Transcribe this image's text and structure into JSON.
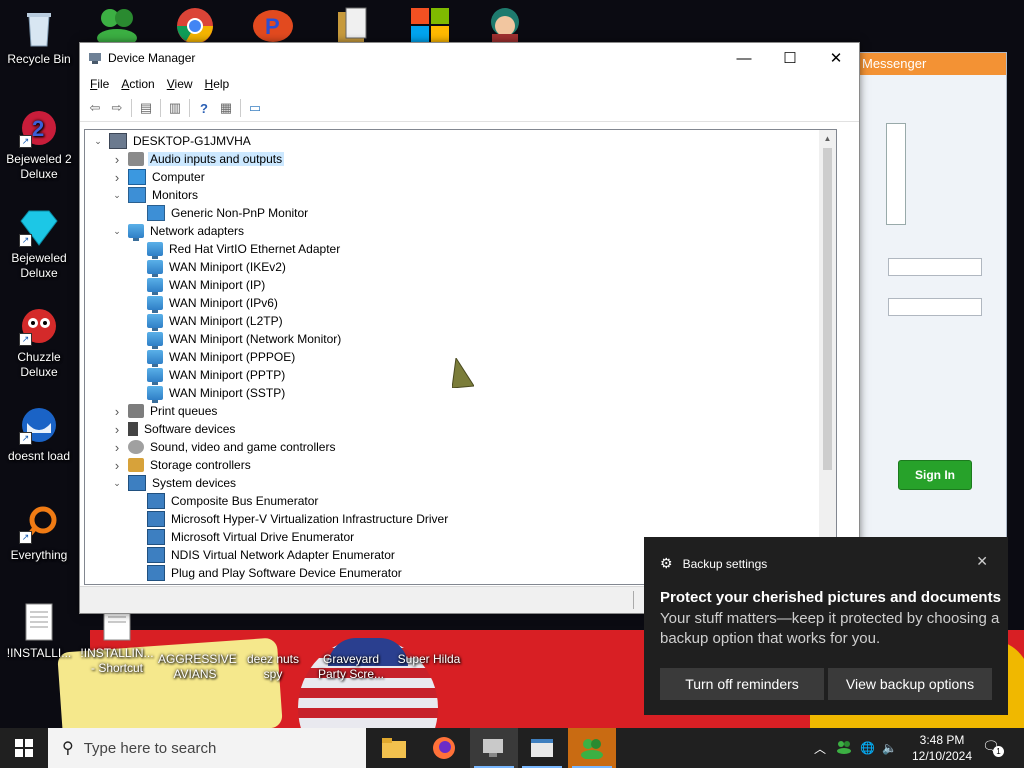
{
  "desktop_icons": [
    {
      "label": "Recycle Bin"
    },
    {
      "label": "Bejeweled 2 Deluxe"
    },
    {
      "label": "Bejeweled Deluxe"
    },
    {
      "label": "Chuzzle Deluxe"
    },
    {
      "label": "doesnt load"
    },
    {
      "label": "Everything"
    },
    {
      "label": "!INSTALLI..."
    },
    {
      "label": "!INSTALLIN... - Shortcut"
    },
    {
      "label": "AGGRESSIVE AVIANS"
    },
    {
      "label": "deez nuts spy"
    },
    {
      "label": "Graveyard Party Scre..."
    },
    {
      "label": "Super Hilda"
    }
  ],
  "messenger": {
    "title": "Messenger",
    "sign_in_label": "Sign In"
  },
  "device_manager": {
    "title": "Device Manager",
    "menu": [
      "File",
      "Action",
      "View",
      "Help"
    ],
    "tree": [
      {
        "label": "DESKTOP-G1JMVHA",
        "level": 0,
        "expander": "open",
        "icon": "host"
      },
      {
        "label": "Audio inputs and outputs",
        "level": 1,
        "expander": "closed",
        "icon": "audio",
        "selected": true
      },
      {
        "label": "Computer",
        "level": 1,
        "expander": "closed",
        "icon": "pc"
      },
      {
        "label": "Monitors",
        "level": 1,
        "expander": "open",
        "icon": "mon"
      },
      {
        "label": "Generic Non-PnP Monitor",
        "level": 2,
        "expander": "none",
        "icon": "mon"
      },
      {
        "label": "Network adapters",
        "level": 1,
        "expander": "open",
        "icon": "net"
      },
      {
        "label": "Red Hat VirtIO Ethernet Adapter",
        "level": 2,
        "expander": "none",
        "icon": "net"
      },
      {
        "label": "WAN Miniport (IKEv2)",
        "level": 2,
        "expander": "none",
        "icon": "net"
      },
      {
        "label": "WAN Miniport (IP)",
        "level": 2,
        "expander": "none",
        "icon": "net"
      },
      {
        "label": "WAN Miniport (IPv6)",
        "level": 2,
        "expander": "none",
        "icon": "net"
      },
      {
        "label": "WAN Miniport (L2TP)",
        "level": 2,
        "expander": "none",
        "icon": "net"
      },
      {
        "label": "WAN Miniport (Network Monitor)",
        "level": 2,
        "expander": "none",
        "icon": "net"
      },
      {
        "label": "WAN Miniport (PPPOE)",
        "level": 2,
        "expander": "none",
        "icon": "net"
      },
      {
        "label": "WAN Miniport (PPTP)",
        "level": 2,
        "expander": "none",
        "icon": "net"
      },
      {
        "label": "WAN Miniport (SSTP)",
        "level": 2,
        "expander": "none",
        "icon": "net"
      },
      {
        "label": "Print queues",
        "level": 1,
        "expander": "closed",
        "icon": "print"
      },
      {
        "label": "Software devices",
        "level": 1,
        "expander": "closed",
        "icon": "soft"
      },
      {
        "label": "Sound, video and game controllers",
        "level": 1,
        "expander": "closed",
        "icon": "sound"
      },
      {
        "label": "Storage controllers",
        "level": 1,
        "expander": "closed",
        "icon": "storage"
      },
      {
        "label": "System devices",
        "level": 1,
        "expander": "open",
        "icon": "sys"
      },
      {
        "label": "Composite Bus Enumerator",
        "level": 2,
        "expander": "none",
        "icon": "sys"
      },
      {
        "label": "Microsoft Hyper-V Virtualization Infrastructure Driver",
        "level": 2,
        "expander": "none",
        "icon": "sys"
      },
      {
        "label": "Microsoft Virtual Drive Enumerator",
        "level": 2,
        "expander": "none",
        "icon": "sys"
      },
      {
        "label": "NDIS Virtual Network Adapter Enumerator",
        "level": 2,
        "expander": "none",
        "icon": "sys"
      },
      {
        "label": "Plug and Play Software Device Enumerator",
        "level": 2,
        "expander": "none",
        "icon": "sys"
      }
    ]
  },
  "notification": {
    "app": "Backup settings",
    "heading": "Protect your cherished pictures and documents",
    "body": "Your stuff matters—keep it protected by choosing a backup option that works for you.",
    "button_1": "Turn off reminders",
    "button_2": "View backup options",
    "close_icon": "close-icon"
  },
  "taskbar": {
    "search_placeholder": "Type here to search",
    "time": "3:48 PM",
    "date": "12/10/2024",
    "notification_count": "1"
  },
  "colors": {
    "selection": "#cce8ff",
    "taskbar": "#202020",
    "toast": "#1f1f1f",
    "sign_in_green": "#27a22a"
  }
}
